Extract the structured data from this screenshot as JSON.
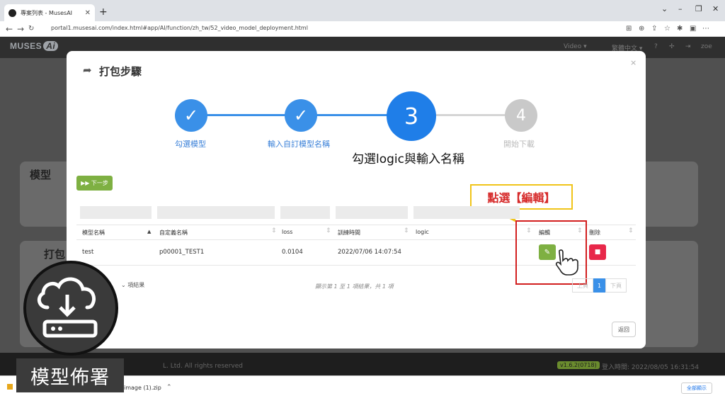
{
  "browser": {
    "tab_title": "專案列表 - MusesAI",
    "url": "portal1.musesai.com/index.html#app/AI/function/zh_tw/52_video_model_deployment.html"
  },
  "app": {
    "logo_text": "MUSES",
    "logo_ai": "Ai",
    "nav_video": "Video ▾",
    "nav_lang": "繁體中文 ▾",
    "user": "zoe",
    "bg_card1_title": "模型",
    "bg_card2_title": "打包",
    "copyright": "L. Ltd. All rights reserved",
    "version": "v1.6.2(0718)",
    "login_time": "登入時間: 2022/08/05 16:31:54"
  },
  "downloads": {
    "file_name": "image (1).zip",
    "show_all": "全部顯示"
  },
  "modal": {
    "title": "打包步驟",
    "steps": [
      {
        "number": "✓",
        "label": "勾選模型"
      },
      {
        "number": "✓",
        "label": "輸入自訂模型名稱"
      },
      {
        "number": "3",
        "label": "勾選logic與輸入名稱"
      },
      {
        "number": "4",
        "label": "開始下載"
      }
    ],
    "next_label": "▶▶ 下一步",
    "callout": "點選【編輯】",
    "table": {
      "headers": [
        "模型名稱",
        "自定義名稱",
        "loss",
        "訓練時間",
        "logic",
        "編輯",
        "刪除"
      ],
      "rows": [
        {
          "model": "test",
          "custom": "p00001_TEST1",
          "loss": "0.0104",
          "time": "2022/07/06 14:07:54",
          "logic": ""
        }
      ]
    },
    "page_size_label": "項結果",
    "page_info": "顯示第 1 至 1 項結果，共 1 項",
    "pagination": {
      "prev": "上頁",
      "current": "1",
      "next": "下頁"
    },
    "back_label": "返回"
  },
  "badge": {
    "label": "模型佈署",
    "icon": "cloud-download-icon"
  }
}
